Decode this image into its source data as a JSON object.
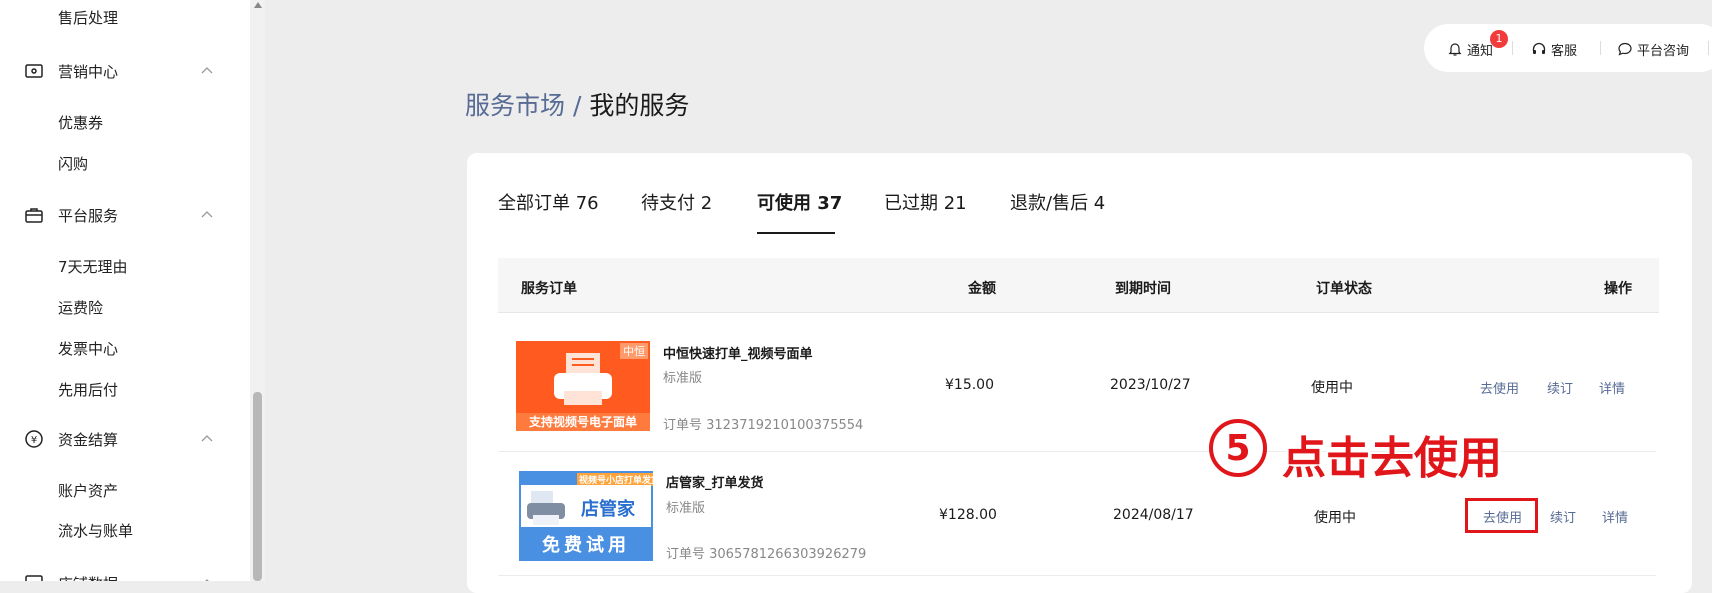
{
  "sidebar": {
    "items": [
      {
        "label": "售后处理"
      },
      {
        "label": "营销中心"
      },
      {
        "label": "优惠券"
      },
      {
        "label": "闪购"
      },
      {
        "label": "平台服务"
      },
      {
        "label": "7天无理由"
      },
      {
        "label": "运费险"
      },
      {
        "label": "发票中心"
      },
      {
        "label": "先用后付"
      },
      {
        "label": "资金结算"
      },
      {
        "label": "账户资产"
      },
      {
        "label": "流水与账单"
      },
      {
        "label": "店铺数据"
      }
    ]
  },
  "topbar": {
    "notify_label": "通知",
    "notify_count": "1",
    "service_label": "客服",
    "consult_label": "平台咨询"
  },
  "header": {
    "breadcrumb": "服务市场 /",
    "title": "我的服务"
  },
  "tabs": [
    {
      "label": "全部订单 76"
    },
    {
      "label": "待支付 2"
    },
    {
      "label": "可使用 37"
    },
    {
      "label": "已过期 21"
    },
    {
      "label": "退款/售后 4"
    }
  ],
  "table": {
    "columns": [
      "服务订单",
      "金额",
      "到期时间",
      "订单状态",
      "操作"
    ],
    "order_prefix": "订单号",
    "rows": [
      {
        "thumb_badge": "中恒",
        "thumb_caption": "支持视频号电子面单",
        "name": "中恒快速打单_视频号面单",
        "version": "标准版",
        "order_no": "订单号 3123719210100375554",
        "amount": "¥15.00",
        "expire": "2023/10/27",
        "status": "使用中",
        "ops": [
          "去使用",
          "续订",
          "详情"
        ]
      },
      {
        "thumb_banner": "视频号小店打单发货",
        "thumb_title": "店管家",
        "thumb_caption": "免费试用",
        "name": "店管家_打单发货",
        "version": "标准版",
        "order_no": "订单号 3065781266303926279",
        "amount": "¥128.00",
        "expire": "2024/08/17",
        "status": "使用中",
        "ops": [
          "去使用",
          "续订",
          "详情"
        ]
      }
    ]
  },
  "annotation": {
    "step": "5",
    "text": "点击去使用",
    "color": "#e0161b"
  },
  "colors": {
    "link": "#576b95",
    "thumb1_bg": "#ff5a1f",
    "thumb2_bg": "#4a90e2"
  }
}
